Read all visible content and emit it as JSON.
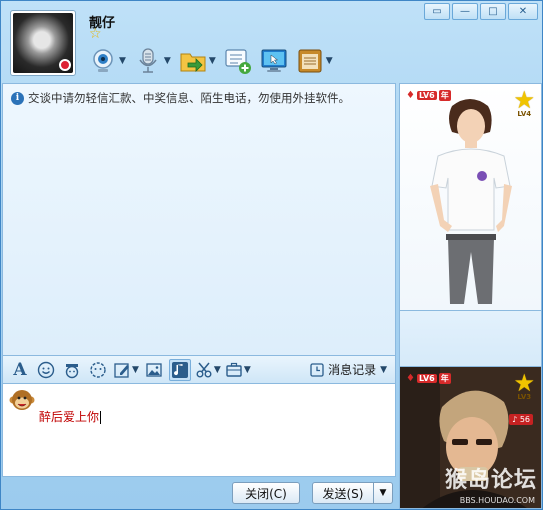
{
  "window": {
    "controls": [
      "▭",
      "—",
      "□",
      "✕"
    ]
  },
  "header": {
    "username": "靓仔",
    "level_icon": "crown-star-icon"
  },
  "toolbar": {
    "tools": [
      "webcam-icon",
      "microphone-icon",
      "file-transfer-icon",
      "message-add-icon",
      "remote-desktop-icon",
      "app-box-icon"
    ]
  },
  "chat": {
    "notice": "交谈中请勿轻信汇款、中奖信息、陌生电话，勿使用外挂软件。"
  },
  "format_bar": {
    "history_label": "消息记录"
  },
  "input": {
    "text": "醉后爱上你"
  },
  "buttons": {
    "close_label": "关闭(C)",
    "send_label": "发送(S)"
  },
  "show_top": {
    "badge_lv": "LV6",
    "badge_year": "年",
    "star_label": "LV4"
  },
  "show_bottom": {
    "badge_lv": "LV6",
    "badge_year": "年",
    "star_label": "LV3",
    "vol_value": "56",
    "watermark": "猴岛论坛",
    "watermark_url": "BBS.HOUDAO.COM"
  },
  "colors": {
    "accent": "#3f86c6",
    "input_text": "#c00000",
    "badge_red": "#d62a2a"
  }
}
